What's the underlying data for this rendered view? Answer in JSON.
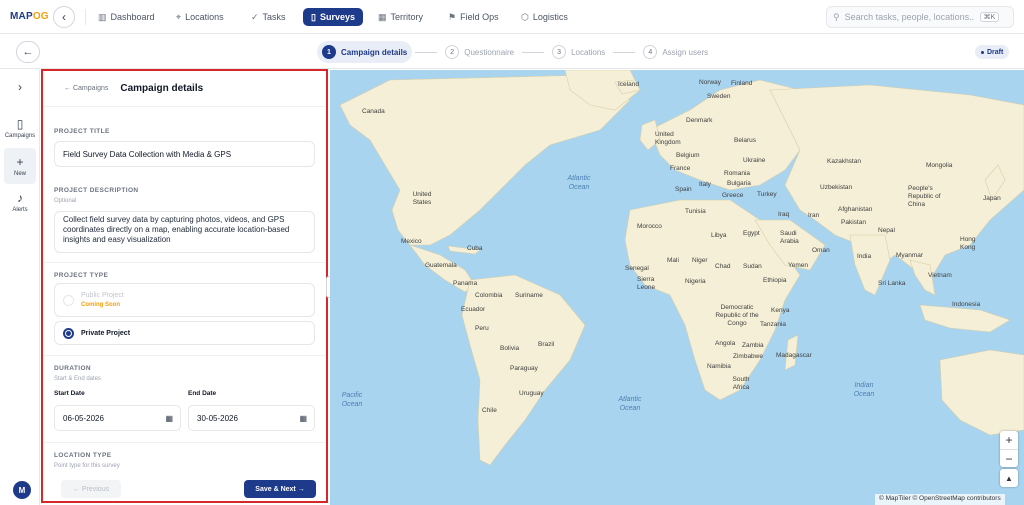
{
  "logo": {
    "part1": "MAP",
    "part2": "OG"
  },
  "nav": [
    {
      "label": "Dashboard",
      "icon": "bar-chart-icon"
    },
    {
      "label": "Locations",
      "icon": "pin-icon"
    },
    {
      "label": "Tasks",
      "icon": "check-icon"
    },
    {
      "label": "Surveys",
      "icon": "clipboard-icon",
      "active": true
    },
    {
      "label": "Territory",
      "icon": "map-icon"
    },
    {
      "label": "Field Ops",
      "icon": "flag-icon"
    },
    {
      "label": "Logistics",
      "icon": "box-icon"
    }
  ],
  "search": {
    "placeholder": "Search tasks, people, locations...",
    "shortcut": "⌘K"
  },
  "steps": [
    {
      "num": "1",
      "label": "Campaign details",
      "active": true
    },
    {
      "num": "2",
      "label": "Questionnaire"
    },
    {
      "num": "3",
      "label": "Locations"
    },
    {
      "num": "4",
      "label": "Assign users"
    }
  ],
  "status_badge": "Draft",
  "rail": {
    "items": [
      {
        "label": "Campaigns",
        "icon": "clipboard-icon"
      },
      {
        "label": "New",
        "icon": "plus-icon"
      },
      {
        "label": "Alerts",
        "icon": "bell-icon"
      }
    ],
    "avatar": "M"
  },
  "form": {
    "breadcrumb": "← Campaigns",
    "title": "Campaign details",
    "project_title_label": "PROJECT TITLE",
    "project_title_value": "Field Survey Data Collection with Media & GPS",
    "description_label": "PROJECT DESCRIPTION",
    "description_hint": "Optional",
    "description_value": "Collect field survey data by capturing photos, videos, and GPS coordinates directly on a map, enabling accurate location-based insights and easy visualization",
    "project_type_label": "PROJECT TYPE",
    "public_option": "Public Project",
    "public_badge": "Coming Soon",
    "private_option": "Private Project",
    "duration_label": "DURATION",
    "duration_hint": "Start & End dates",
    "start_label": "Start Date",
    "start_value": "06-05-2026",
    "end_label": "End Date",
    "end_value": "30-05-2026",
    "location_type_label": "LOCATION TYPE",
    "location_type_hint": "Point type for this survey",
    "prev_button": "← Previous",
    "next_button": "Save & Next →"
  },
  "map": {
    "labels": [
      "Iceland",
      "Norway",
      "Finland",
      "Sweden",
      "Canada",
      "Denmark",
      "United Kingdom",
      "Belarus",
      "Belgium",
      "Ukraine",
      "Kazakhstan",
      "France",
      "Romania",
      "Bulgaria",
      "Uzbekistan",
      "Mongolia",
      "Spain",
      "Italy",
      "Greece",
      "Turkey",
      "People's Republic of China",
      "Japan",
      "United States",
      "Atlantic Ocean",
      "Tunisia",
      "Iraq",
      "Iran",
      "Afghanistan",
      "Morocco",
      "Libya",
      "Egypt",
      "Saudi Arabia",
      "Pakistan",
      "Mexico",
      "Cuba",
      "Oman",
      "Nepal",
      "Hong Kong",
      "Guatemala",
      "Mali",
      "Niger",
      "Chad",
      "Sudan",
      "Yemen",
      "India",
      "Myanmar",
      "Senegal",
      "Sierra Leone",
      "Nigeria",
      "Ethiopia",
      "Vietnam",
      "Panama",
      "Colombia",
      "Suriname",
      "Ecuador",
      "Democratic Republic of the Congo",
      "Kenya",
      "Sri Lanka",
      "Tanzania",
      "Indonesia",
      "Peru",
      "Brazil",
      "Bolivia",
      "Angola",
      "Zambia",
      "Zimbabwe",
      "Madagascar",
      "Paraguay",
      "Namibia",
      "South Africa",
      "Pacific Ocean",
      "Chile",
      "Uruguay",
      "Atlantic Ocean",
      "Indian Ocean"
    ],
    "zoom_in": "+",
    "zoom_out": "−",
    "compass": "▲",
    "attribution": "© MapTiler © OpenStreetMap contributors"
  }
}
